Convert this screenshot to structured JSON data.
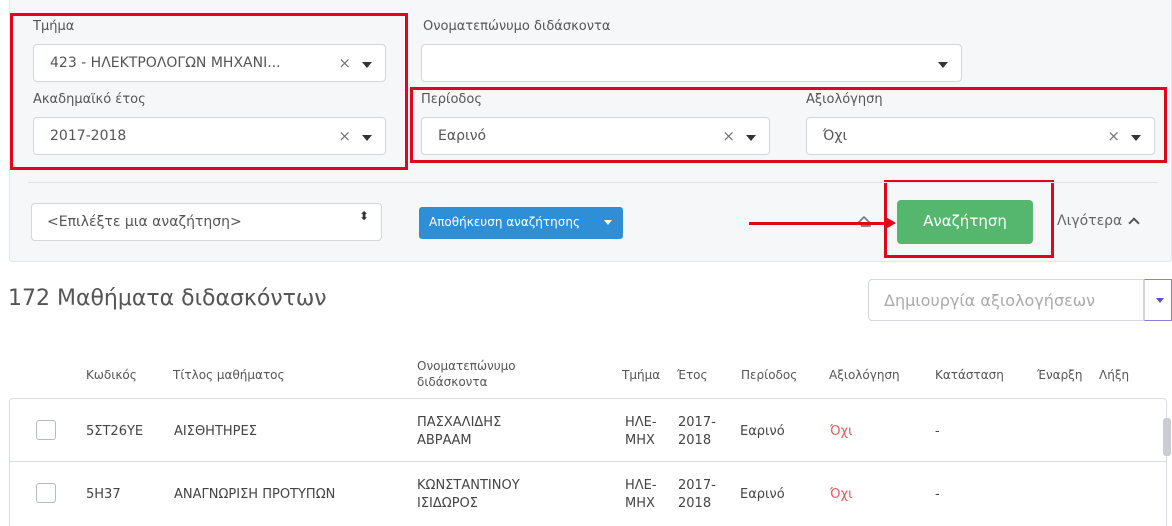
{
  "filters": {
    "department": {
      "label": "Τμήμα",
      "value": "423 - ΗΛΕΚΤΡΟΛΟΓΩΝ ΜΗΧΑΝΙ...",
      "clear": "×"
    },
    "teacher": {
      "label": "Ονοματεπώνυμο διδάσκοντα",
      "value": ""
    },
    "academic_year": {
      "label": "Ακαδημαϊκό έτος",
      "value": "2017-2018",
      "clear": "×"
    },
    "period": {
      "label": "Περίοδος",
      "value": "Εαρινό",
      "clear": "×"
    },
    "evaluation": {
      "label": "Αξιολόγηση",
      "value": "Όχι",
      "clear": "×"
    }
  },
  "actions": {
    "saved_search_placeholder": "<Επιλέξτε μια αναζήτηση>",
    "saved_search_arrows": "⬍",
    "save_search_label": "Αποθήκευση αναζήτησης",
    "eraser_icon": "eraser-icon",
    "search_label": "Αναζήτηση",
    "less_label": "Λιγότερα"
  },
  "results": {
    "title": "172 Μαθήματα διδασκόντων",
    "create_evaluations_label": "Δημιουργία αξιολογήσεων"
  },
  "table": {
    "headers": {
      "code": "Κωδικός",
      "title": "Τίτλος μαθήματος",
      "teacher_1": "Ονοματεπώνυμο",
      "teacher_2": "διδάσκοντα",
      "department": "Τμήμα",
      "year": "Έτος",
      "period": "Περίοδος",
      "evaluation": "Αξιολόγηση",
      "status": "Κατάσταση",
      "start": "Έναρξη",
      "end": "Λήξη"
    },
    "rows": [
      {
        "code": "5ΣΤ26ΥΕ",
        "title": "ΑΙΣΘΗΤΗΡΕΣ",
        "teacher_1": "ΠΑΣΧΑΛΙΔΗΣ",
        "teacher_2": "ΑΒΡΑΑΜ",
        "dept_1": "ΗΛΕ-",
        "dept_2": "ΜΗΧ",
        "year_1": "2017-",
        "year_2": "2018",
        "period": "Εαρινό",
        "evaluation": "Όχι",
        "status": "-"
      },
      {
        "code": "5Η37",
        "title": "ΑΝΑΓΝΩΡΙΣΗ ΠΡΟΤΥΠΩΝ",
        "teacher_1": "ΚΩΝΣΤΑΝΤΙΝΟΥ",
        "teacher_2": "ΙΣΙΔΩΡΟΣ",
        "dept_1": "ΗΛΕ-",
        "dept_2": "ΜΗΧ",
        "year_1": "2017-",
        "year_2": "2018",
        "period": "Εαρινό",
        "evaluation": "Όχι",
        "status": "-"
      }
    ]
  },
  "colors": {
    "highlight": "#e2061a",
    "primary": "#2f8fd6",
    "success": "#55b76d",
    "negative": "#e05a5a"
  }
}
